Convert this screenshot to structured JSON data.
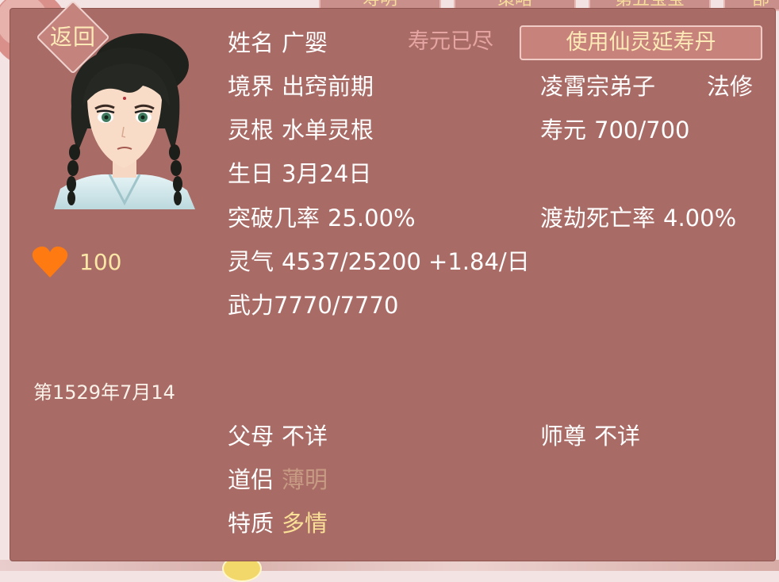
{
  "background": {
    "tabs": [
      "寿明",
      "策略",
      "第五宝宝",
      "部"
    ]
  },
  "back_button": {
    "label": "返回"
  },
  "favor": {
    "value": "100",
    "icon": "heart-icon",
    "color": "#ff7a10"
  },
  "date": "第1529年7月14",
  "character": {
    "name": {
      "label": "姓名",
      "value": "广婴"
    },
    "lifespan_status": "寿元已尽",
    "use_item_button": "使用仙灵延寿丹",
    "realm": {
      "label": "境界",
      "value": "出窍前期"
    },
    "sect": "凌霄宗弟子",
    "school": "法修",
    "spirit_root": {
      "label": "灵根",
      "value": "水单灵根"
    },
    "lifespan": {
      "label": "寿元",
      "value": "700/700"
    },
    "birthday": {
      "label": "生日",
      "value": "3月24日"
    },
    "breakthrough": {
      "label": "突破几率",
      "value": "25.00%"
    },
    "tribulation_death": {
      "label": "渡劫死亡率",
      "value": "4.00%"
    },
    "qi": {
      "label": "灵气",
      "value": "4537/25200 +1.84/日"
    },
    "force": {
      "label": "武力",
      "value": "7770/7770"
    },
    "parents": {
      "label": "父母",
      "value": "不详"
    },
    "master": {
      "label": "师尊",
      "value": "不详"
    },
    "partner": {
      "label": "道侣",
      "value": "薄明"
    },
    "trait": {
      "label": "特质",
      "value": "多情"
    }
  },
  "colors": {
    "panel": "#a96b66",
    "label_text": "#ffffff",
    "gold_text": "#fbe197",
    "muted_text": "#c79b83",
    "warning_text": "#e6a5a3"
  }
}
